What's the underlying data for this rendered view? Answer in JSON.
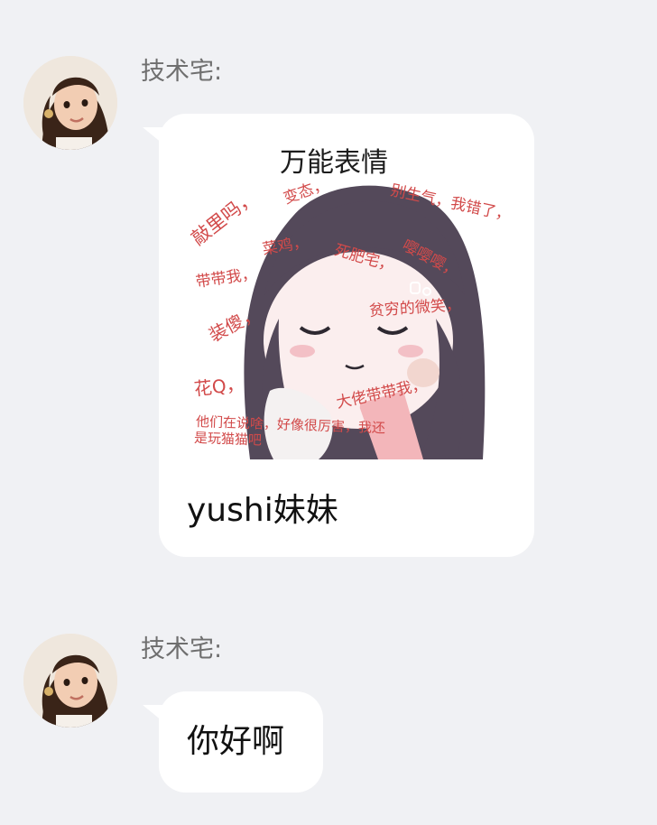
{
  "chat": {
    "messages": [
      {
        "sender": "技术宅:",
        "text": "yushi妹妹",
        "sticker": {
          "title": "万能表情",
          "phrases": [
            "别生气，我错了，",
            "敲里吗，",
            "变态，",
            "带带我，",
            "菜鸡，",
            "死肥宅，",
            "嘤嘤嘤，",
            "装傻，",
            "贫穷的微笑，",
            "花Q，",
            "大佬带带我，",
            "他们在说啥，好像很厉害，我还",
            "是玩猫猫吧"
          ]
        }
      },
      {
        "sender": "技术宅:",
        "text": "你好啊"
      }
    ]
  },
  "icons": {
    "avatar": "user-avatar-photo"
  }
}
